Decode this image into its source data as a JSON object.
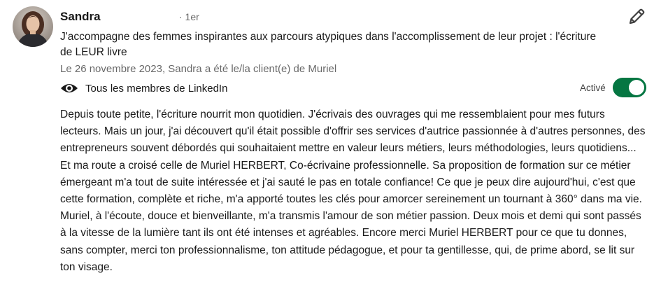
{
  "recommendation": {
    "author_name": "Sandra",
    "connection_degree": "· 1er",
    "headline": "J'accompagne des femmes inspirantes aux parcours atypiques dans l'accomplissement de leur projet : l'écriture de LEUR livre",
    "date_line": "Le 26 novembre 2023, Sandra a été le/la client(e) de Muriel",
    "visibility_label": "Tous les membres de LinkedIn",
    "status_label": "Activé",
    "toggle_on": true,
    "body": "Depuis toute petite, l'écriture nourrit mon quotidien. J'écrivais des ouvrages qui me ressemblaient pour mes futurs lecteurs. Mais un jour, j'ai découvert qu'il était possible d'offrir ses services d'autrice passionnée à d'autres personnes, des entrepreneurs souvent débordés qui souhaitaient mettre en valeur leurs métiers, leurs méthodologies, leurs quotidiens... Et ma route a croisé celle de Muriel HERBERT, Co-écrivaine professionnelle. Sa proposition de formation sur ce métier émergeant m'a tout de suite intéressée et j'ai sauté le pas en totale confiance! Ce que je peux dire aujourd'hui, c'est que cette formation, complète et riche, m'a apporté toutes les clés pour amorcer sereinement un tournant à 360° dans ma vie. Muriel, à l'écoute, douce et bienveillante, m'a transmis l'amour de son métier passion. Deux mois et demi qui sont passés à la vitesse de la lumière tant ils ont été intenses et agréables. Encore merci Muriel HERBERT pour ce que tu donnes, sans compter, merci ton professionnalisme, ton attitude pédagogue, et pour ta gentillesse, qui, de prime abord, se lit sur ton visage."
  },
  "icons": {
    "edit": "pencil-icon",
    "visibility": "eye-icon"
  },
  "colors": {
    "toggle_on": "#057642",
    "secondary_text": "#666666",
    "primary_text": "#191919"
  }
}
